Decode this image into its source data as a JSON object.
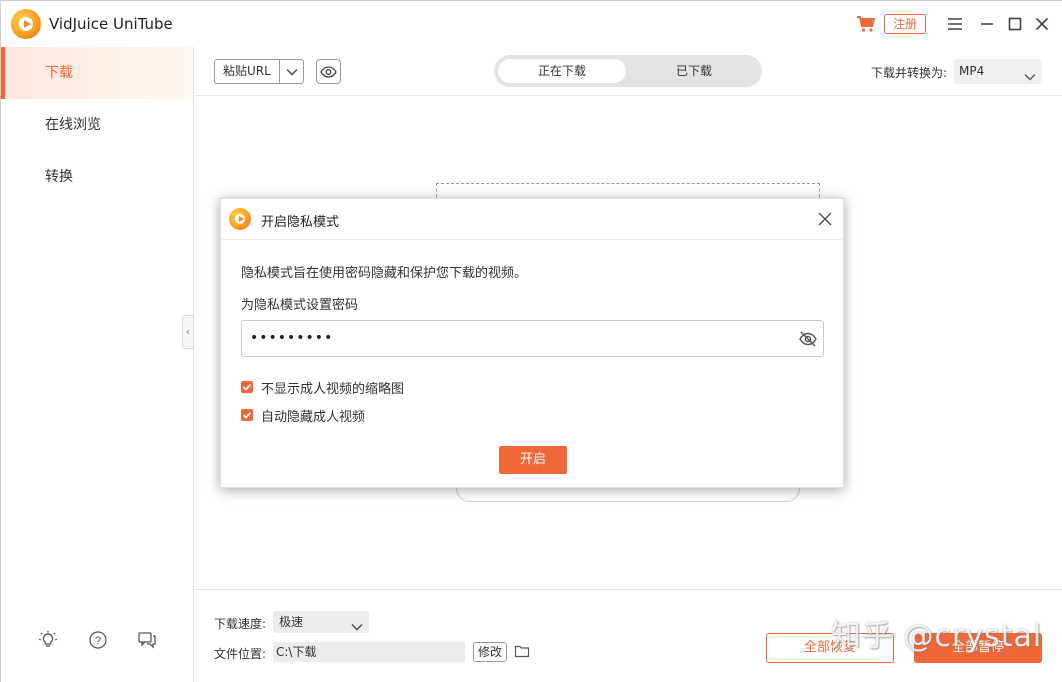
{
  "app": {
    "title": "VidJuice UniTube",
    "register_label": "注册"
  },
  "sidebar": {
    "items": [
      {
        "label": "下载",
        "active": true
      },
      {
        "label": "在线浏览",
        "active": false
      },
      {
        "label": "转换",
        "active": false
      }
    ],
    "bottom_icons": [
      "lightbulb-icon",
      "help-icon",
      "feedback-icon"
    ]
  },
  "toolbar": {
    "paste_label": "粘贴URL",
    "tabs": [
      {
        "label": "正在下载",
        "active": true
      },
      {
        "label": "已下载",
        "active": false
      }
    ],
    "format_label": "下载并转换为:",
    "format_value": "MP4"
  },
  "footer": {
    "speed_label": "下载速度:",
    "speed_value": "极速",
    "location_label": "文件位置:",
    "location_value": "C:\\下载",
    "modify_label": "修改",
    "resume_all": "全部恢复",
    "pause_all": "全部暂停"
  },
  "modal": {
    "title": "开启隐私模式",
    "description": "隐私模式旨在使用密码隐藏和保护您下载的视频。",
    "password_label": "为隐私模式设置密码",
    "password_value": "•••••••••",
    "checkboxes": [
      {
        "label": "不显示成人视频的缩略图",
        "checked": true
      },
      {
        "label": "自动隐藏成人视频",
        "checked": true
      }
    ],
    "confirm_label": "开启"
  },
  "watermark": "知乎 @crystal",
  "colors": {
    "accent": "#f0683a",
    "sidebar_active_bg": "#fde7dc",
    "segment_bg": "#e3e3e3"
  }
}
